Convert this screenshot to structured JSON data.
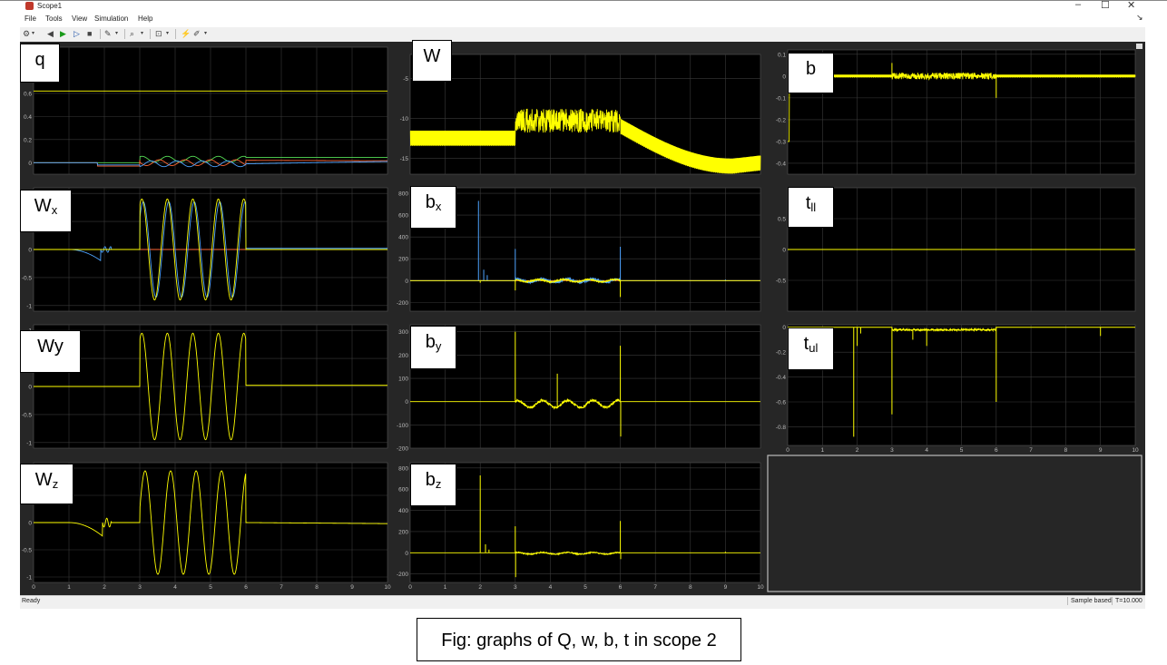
{
  "window": {
    "title": "Scope1",
    "controls": [
      "–",
      "☐",
      "✕"
    ]
  },
  "menu": [
    "File",
    "Tools",
    "View",
    "Simulation",
    "Help"
  ],
  "status": {
    "left": "Ready",
    "mode": "Sample based",
    "time": "T=10.000"
  },
  "caption": "Fig: graphs of Q, w, b, t in scope 2",
  "labels": {
    "q": "q",
    "W": "W",
    "b": "b",
    "Wx_main": "W",
    "Wx_sub": "x",
    "bx_main": "b",
    "bx_sub": "x",
    "tll_main": "t",
    "tll_sub": "ll",
    "Wy": "Wy",
    "by_main": "b",
    "by_sub": "y",
    "tul_main": "t",
    "tul_sub": "ul",
    "Wz_main": "W",
    "Wz_sub": "z",
    "bz_main": "b",
    "bz_sub": "z"
  },
  "colors": {
    "plot_bg": "#000000",
    "grid": "#3a3a3a",
    "yellow": "#ffff00",
    "blue": "#4da3ff",
    "red": "#ff6633",
    "green": "#55dd55",
    "tick": "#bbbbbb"
  },
  "chart_data": [
    {
      "name": "q",
      "type": "line",
      "xlim": [
        0,
        10
      ],
      "ylim": [
        -0.1,
        1
      ],
      "yticks": [
        "0",
        "0.2",
        "0.4",
        "0.6"
      ],
      "yticks_v": [
        0,
        0.2,
        0.4,
        0.6
      ],
      "xticks": [],
      "series": [
        {
          "color": "yellow",
          "kind": "q_yellow"
        },
        {
          "color": "green",
          "kind": "q_green"
        },
        {
          "color": "red",
          "kind": "q_red"
        },
        {
          "color": "blue",
          "kind": "q_blue"
        }
      ]
    },
    {
      "name": "W",
      "type": "line",
      "xlim": [
        0,
        10
      ],
      "ylim": [
        -17,
        -2
      ],
      "yticks": [
        "-5",
        "-10",
        "-15"
      ],
      "yticks_v": [
        -5,
        -10,
        -15
      ],
      "xticks": [],
      "series": [
        {
          "color": "yellow",
          "kind": "W"
        }
      ]
    },
    {
      "name": "b",
      "type": "line",
      "xlim": [
        0,
        10
      ],
      "ylim": [
        -0.45,
        0.12
      ],
      "yticks": [
        "0.1",
        "0",
        "-0.1",
        "-0.2",
        "-0.3",
        "-0.4"
      ],
      "yticks_v": [
        0.1,
        0,
        -0.1,
        -0.2,
        -0.3,
        -0.4
      ],
      "xticks": [],
      "series": [
        {
          "color": "yellow",
          "kind": "b"
        }
      ]
    },
    {
      "name": "Wx",
      "type": "line",
      "xlim": [
        0,
        10
      ],
      "ylim": [
        -1.1,
        1.1
      ],
      "yticks": [
        "1",
        "0.5",
        "0",
        "-0.5",
        "-1"
      ],
      "yticks_v": [
        1,
        0.5,
        0,
        -0.5,
        -1
      ],
      "xticks": [],
      "series": [
        {
          "color": "red",
          "kind": "flat0"
        },
        {
          "color": "blue",
          "kind": "Wx_blue"
        },
        {
          "color": "yellow",
          "kind": "Wx_yellow"
        }
      ]
    },
    {
      "name": "bx",
      "type": "line",
      "xlim": [
        0,
        10
      ],
      "ylim": [
        -280,
        850
      ],
      "yticks": [
        "800",
        "600",
        "400",
        "200",
        "0",
        "-200"
      ],
      "yticks_v": [
        800,
        600,
        400,
        200,
        0,
        -200
      ],
      "xticks": [],
      "series": [
        {
          "color": "red",
          "kind": "flat0"
        },
        {
          "color": "blue",
          "kind": "bx_blue"
        },
        {
          "color": "yellow",
          "kind": "bx_yellow"
        }
      ]
    },
    {
      "name": "tll",
      "type": "line",
      "xlim": [
        0,
        10
      ],
      "ylim": [
        -1,
        1
      ],
      "yticks": [
        "0.5",
        "0",
        "-0.5"
      ],
      "yticks_v": [
        0.5,
        0,
        -0.5
      ],
      "xticks": [],
      "series": [
        {
          "color": "yellow",
          "kind": "flat0"
        }
      ]
    },
    {
      "name": "Wy",
      "type": "line",
      "xlim": [
        0,
        10
      ],
      "ylim": [
        -1.1,
        1.1
      ],
      "yticks": [
        "1",
        "0.5",
        "0",
        "-0.5",
        "-1"
      ],
      "yticks_v": [
        1,
        0.5,
        0,
        -0.5,
        -1
      ],
      "xticks": [],
      "series": [
        {
          "color": "yellow",
          "kind": "Wy"
        }
      ]
    },
    {
      "name": "by",
      "type": "line",
      "xlim": [
        0,
        10
      ],
      "ylim": [
        -200,
        330
      ],
      "yticks": [
        "300",
        "200",
        "100",
        "0",
        "-100",
        "-200"
      ],
      "yticks_v": [
        300,
        200,
        100,
        0,
        -100,
        -200
      ],
      "xticks": [],
      "series": [
        {
          "color": "yellow",
          "kind": "by"
        }
      ]
    },
    {
      "name": "tul",
      "type": "line",
      "xlim": [
        0,
        10
      ],
      "ylim": [
        -0.95,
        0.02
      ],
      "yticks": [
        "0",
        "-0.2",
        "-0.4",
        "-0.6",
        "-0.8"
      ],
      "yticks_v": [
        0,
        -0.2,
        -0.4,
        -0.6,
        -0.8
      ],
      "xticks": [
        "0",
        "1",
        "2",
        "3",
        "4",
        "5",
        "6",
        "7",
        "8",
        "9",
        "10"
      ],
      "series": [
        {
          "color": "yellow",
          "kind": "tul"
        }
      ]
    },
    {
      "name": "Wz",
      "type": "line",
      "xlim": [
        0,
        10
      ],
      "ylim": [
        -1.1,
        1.1
      ],
      "yticks": [
        "1",
        "0.5",
        "0",
        "-0.5",
        "-1"
      ],
      "yticks_v": [
        1,
        0.5,
        0,
        -0.5,
        -1
      ],
      "xticks": [
        "0",
        "1",
        "2",
        "3",
        "4",
        "5",
        "6",
        "7",
        "8",
        "9",
        "10"
      ],
      "series": [
        {
          "color": "yellow",
          "kind": "Wz"
        }
      ]
    },
    {
      "name": "bz",
      "type": "line",
      "xlim": [
        0,
        10
      ],
      "ylim": [
        -280,
        850
      ],
      "yticks": [
        "800",
        "600",
        "400",
        "200",
        "0",
        "-200"
      ],
      "yticks_v": [
        800,
        600,
        400,
        200,
        0,
        -200
      ],
      "xticks": [
        "0",
        "1",
        "2",
        "3",
        "4",
        "5",
        "6",
        "7",
        "8",
        "9",
        "10"
      ],
      "series": [
        {
          "color": "yellow",
          "kind": "bz"
        }
      ]
    }
  ]
}
